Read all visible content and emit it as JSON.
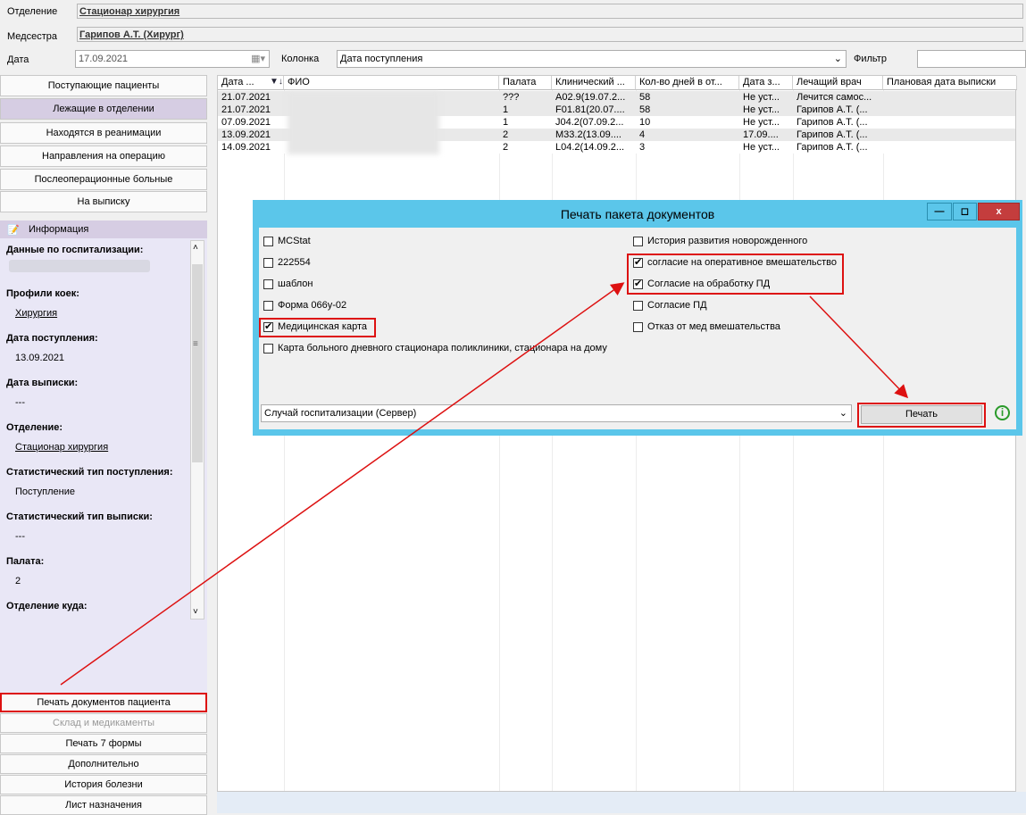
{
  "header": {
    "dept_label": "Отделение",
    "dept_value": "Стационар  хирургия",
    "nurse_label": "Медсестра",
    "nurse_value": "Гарипов А.Т. (Хирург)",
    "date_label": "Дата",
    "date_value": "17.09.2021",
    "column_label": "Колонка",
    "column_value": "Дата поступления",
    "filter_label": "Фильтр"
  },
  "nav": [
    {
      "label": "Поступающие пациенты",
      "selected": false
    },
    {
      "label": "Лежащие в отделении",
      "selected": true
    },
    {
      "label": "Находятся в реанимации",
      "selected": false
    },
    {
      "label": "Направления на операцию",
      "selected": false
    },
    {
      "label": "Послеоперационные больные",
      "selected": false
    },
    {
      "label": "На выписку",
      "selected": false
    }
  ],
  "info": {
    "title": "Информация",
    "sections": [
      {
        "label": "Данные по госпитализации:",
        "value": ""
      },
      {
        "label": "Профили коек:",
        "value": "Хирургия"
      },
      {
        "label": "Дата поступления:",
        "value": "13.09.2021"
      },
      {
        "label": "Дата выписки:",
        "value": "---"
      },
      {
        "label": "Отделение:",
        "value": "Стационар  хирургия"
      },
      {
        "label": "Статистический тип поступления:",
        "value": "Поступление"
      },
      {
        "label": "Статистический тип выписки:",
        "value": "---"
      },
      {
        "label": "Палата:",
        "value": "2"
      },
      {
        "label": "Отделение куда:",
        "value": ""
      }
    ]
  },
  "bottom_buttons": [
    {
      "label": "Печать документов пациента"
    },
    {
      "label": "Склад и медикаменты"
    },
    {
      "label": "Печать 7 формы"
    },
    {
      "label": "Дополнительно"
    },
    {
      "label": "История болезни"
    },
    {
      "label": "Лист назначения"
    }
  ],
  "grid": {
    "columns": [
      "Дата ...",
      "ФИО",
      "Палата",
      "Клинический ...",
      "Кол-во дней в от...",
      "Дата з...",
      "Лечащий врач",
      "Плановая дата выписки"
    ],
    "rows": [
      [
        "21.07.2021",
        "",
        "???",
        "A02.9(19.07.2...",
        "58",
        "Не уст...",
        "Лечится самос..."
      ],
      [
        "21.07.2021",
        "",
        "1",
        "F01.81(20.07....",
        "58",
        "Не уст...",
        "Гарипов А.Т. (..."
      ],
      [
        "07.09.2021",
        "",
        "1",
        "J04.2(07.09.2...",
        "10",
        "Не уст...",
        "Гарипов А.Т. (..."
      ],
      [
        "13.09.2021",
        "",
        "2",
        "M33.2(13.09....",
        "4",
        " 17.09....",
        "Гарипов А.Т. (..."
      ],
      [
        "14.09.2021",
        "",
        "2",
        "L04.2(14.09.2...",
        "3",
        "Не уст...",
        "Гарипов А.Т. (..."
      ]
    ]
  },
  "dialog": {
    "title": "Печать пакета документов",
    "left_items": [
      {
        "label": "MCStat",
        "checked": false
      },
      {
        "label": "222554",
        "checked": false
      },
      {
        "label": "шаблон",
        "checked": false
      },
      {
        "label": "Форма 066у-02",
        "checked": false
      },
      {
        "label": "Медицинская карта",
        "checked": true
      },
      {
        "label": "Карта больного дневного стационара поликлиники, стационара на дому",
        "checked": false
      }
    ],
    "right_items": [
      {
        "label": "История развития новорожденного",
        "checked": false
      },
      {
        "label": "согласие на оперативное вмешательство",
        "checked": true
      },
      {
        "label": "Согласие на обработку ПД",
        "checked": true
      },
      {
        "label": "Согласие ПД",
        "checked": false
      },
      {
        "label": "Отказ от мед вмешательства",
        "checked": false
      }
    ],
    "source_value": "Случай госпитализации (Сервер)",
    "print_label": "Печать"
  }
}
